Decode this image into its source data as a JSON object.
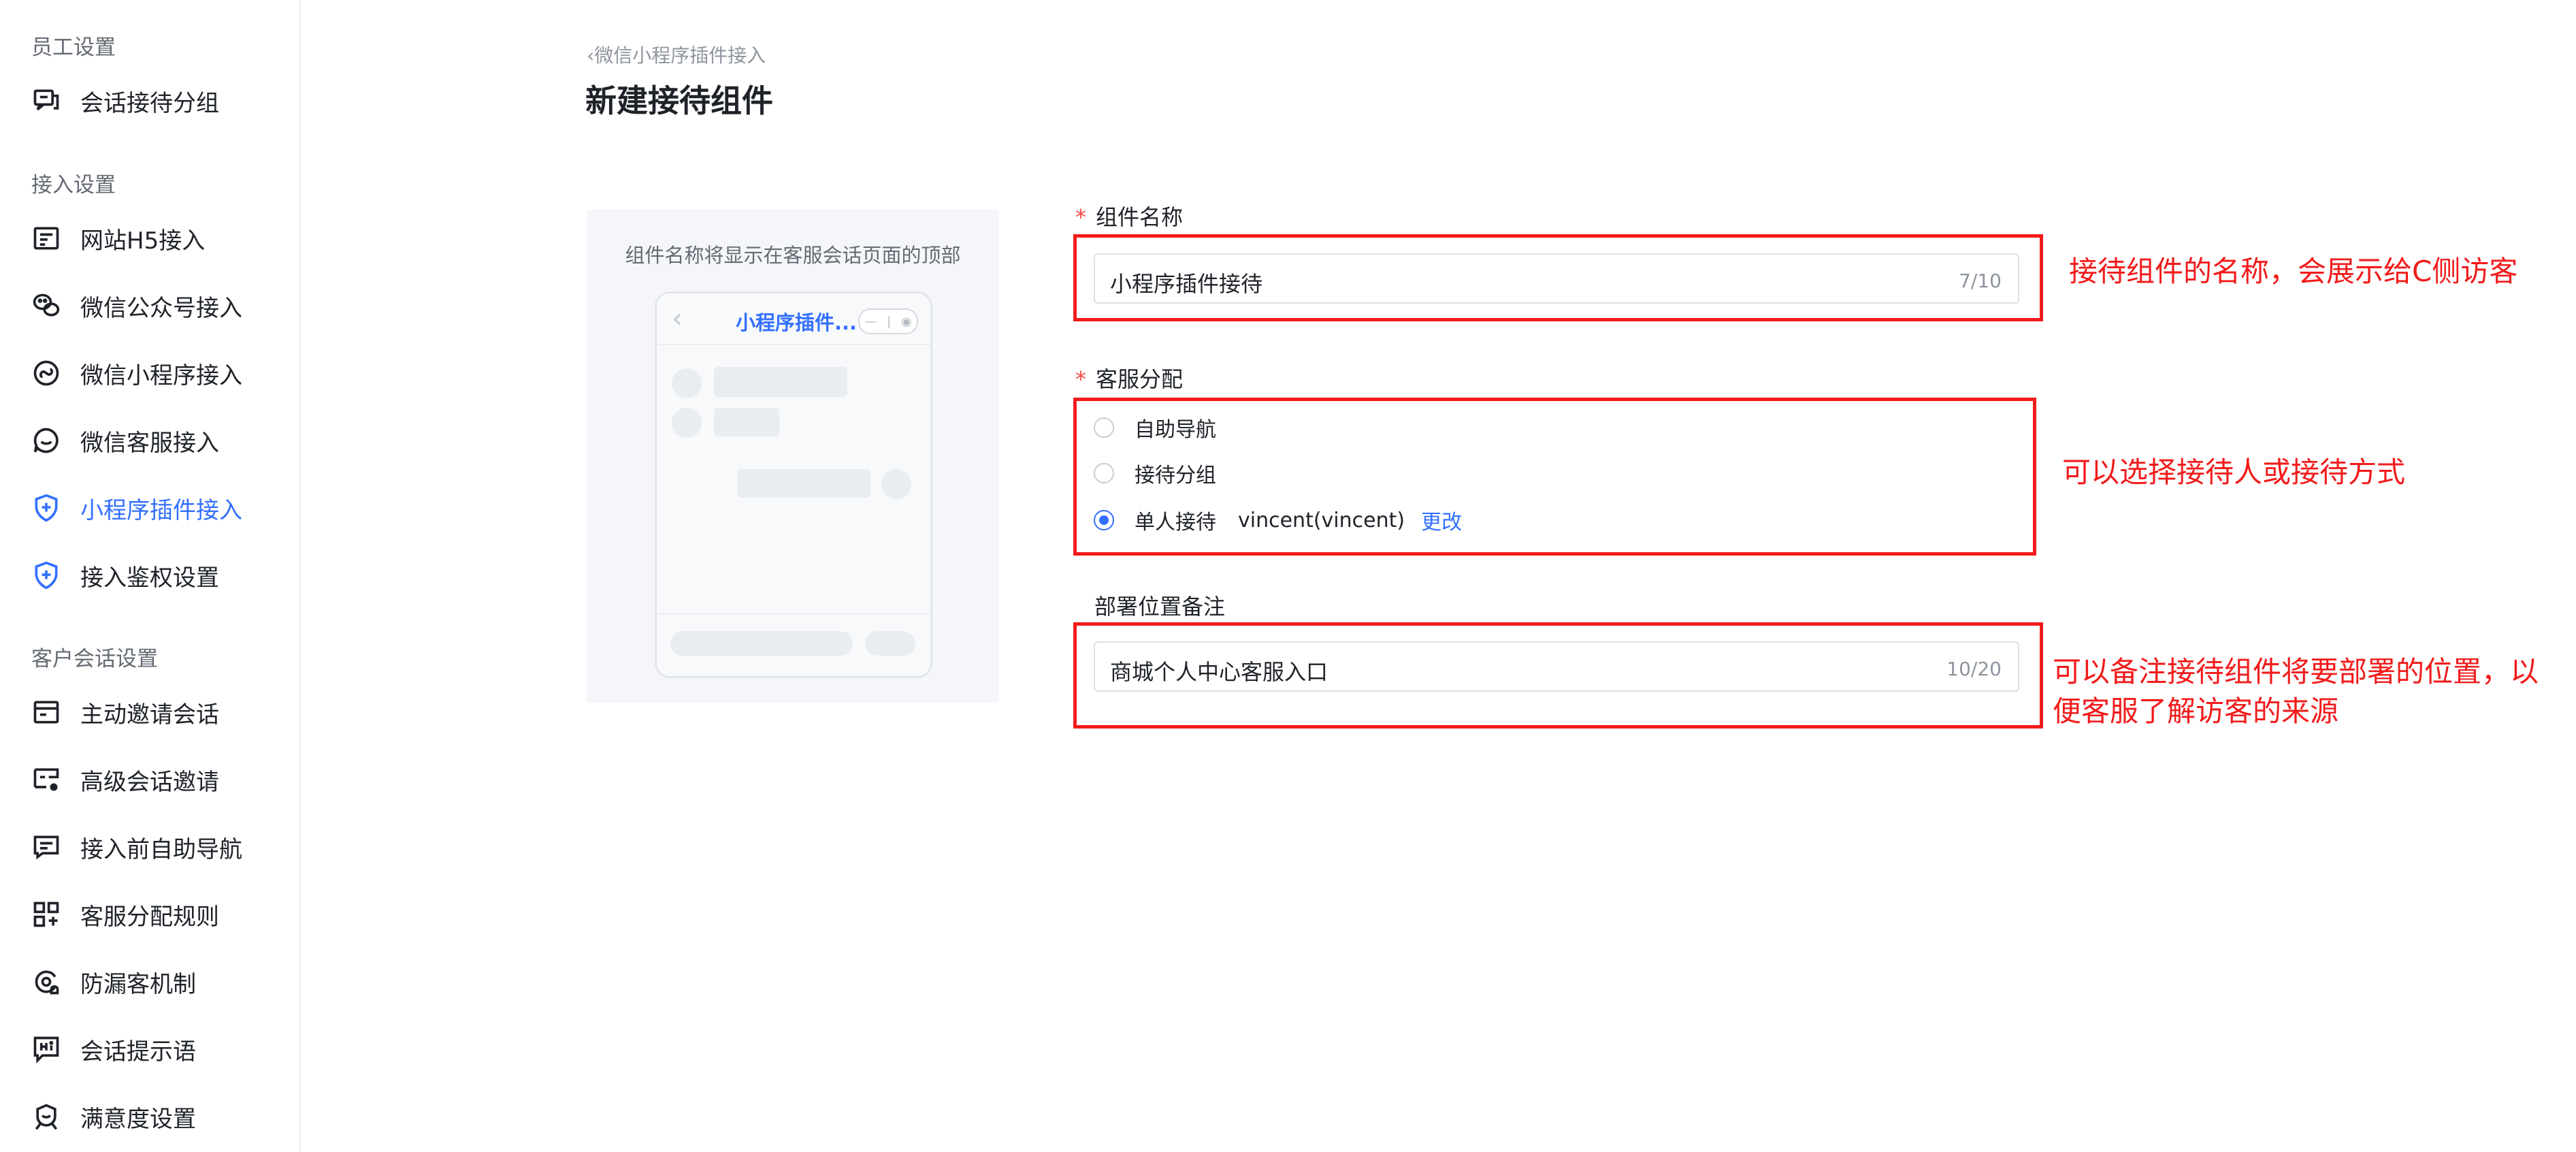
{
  "sidebar": {
    "sections": [
      {
        "title": "员工设置",
        "items": [
          {
            "label": "会话接待分组",
            "icon": "chat-group-icon"
          }
        ]
      },
      {
        "title": "接入设置",
        "items": [
          {
            "label": "网站H5接入",
            "icon": "web-page-icon"
          },
          {
            "label": "微信公众号接入",
            "icon": "wechat-icon"
          },
          {
            "label": "微信小程序接入",
            "icon": "mini-program-icon"
          },
          {
            "label": "微信客服接入",
            "icon": "customer-service-icon"
          },
          {
            "label": "小程序插件接入",
            "icon": "shield-plus-icon",
            "active": true
          },
          {
            "label": "接入鉴权设置",
            "icon": "shield-plus-icon"
          }
        ]
      },
      {
        "title": "客户会话设置",
        "items": [
          {
            "label": "主动邀请会话",
            "icon": "invite-card-icon"
          },
          {
            "label": "高级会话邀请",
            "icon": "advanced-invite-icon"
          },
          {
            "label": "接入前自助导航",
            "icon": "self-navigation-icon"
          },
          {
            "label": "客服分配规则",
            "icon": "assign-rule-icon"
          },
          {
            "label": "防漏客机制",
            "icon": "leak-prevention-icon"
          },
          {
            "label": "会话提示语",
            "icon": "hi-message-icon"
          },
          {
            "label": "满意度设置",
            "icon": "satisfaction-icon"
          }
        ]
      }
    ],
    "active_color": "#3370ff"
  },
  "header": {
    "breadcrumb": "微信小程序插件接入",
    "title": "新建接待组件"
  },
  "preview": {
    "caption": "组件名称将显示在客服会话页面的顶部",
    "phone_title": "小程序插件..."
  },
  "form": {
    "name": {
      "label": "组件名称",
      "value": "小程序插件接待",
      "count": "7/10"
    },
    "assign": {
      "label": "客服分配",
      "options": [
        {
          "label": "自助导航",
          "selected": false
        },
        {
          "label": "接待分组",
          "selected": false
        },
        {
          "label": "单人接待",
          "selected": true
        }
      ],
      "agent": "vincent(vincent)",
      "change_label": "更改"
    },
    "note": {
      "label": "部署位置备注",
      "value": "商城个人中心客服入口",
      "count": "10/20"
    }
  },
  "annotations": {
    "name_note": "接待组件的名称，会展示给C侧访客",
    "assign_note": "可以选择接待人或接待方式",
    "location_note_line1": "可以备注接待组件将要部署的位置，以",
    "location_note_line2": "便客服了解访客的来源",
    "color": "#f21b1b"
  },
  "colors": {
    "primary": "#3370ff",
    "required": "#f54a45"
  }
}
